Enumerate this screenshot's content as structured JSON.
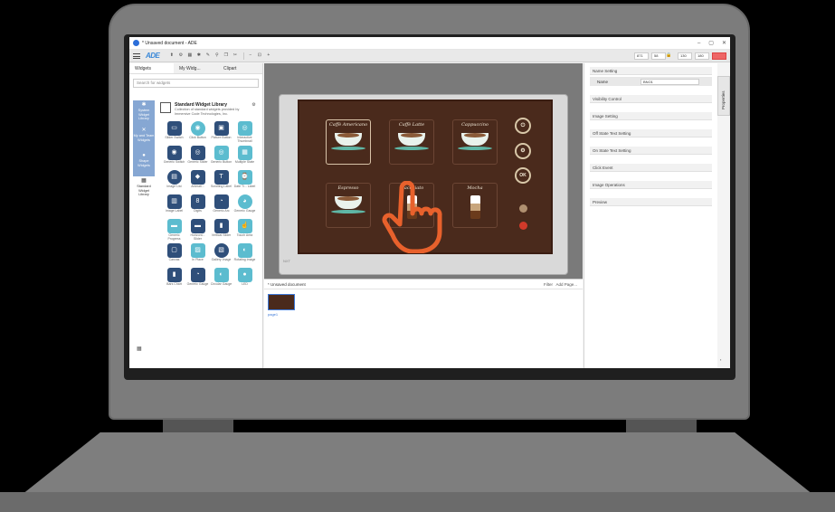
{
  "window": {
    "title": "* Unsaved document - ADE",
    "minimize": "–",
    "maximize": "▢",
    "close": "✕"
  },
  "toolbar": {
    "logo": "ADE",
    "fields": [
      "871",
      "58",
      "130",
      "180"
    ]
  },
  "left_panel": {
    "tabs": [
      "Widgets",
      "My Widg...",
      "Clipart"
    ],
    "search_placeholder": "Search for widgets",
    "categories": [
      {
        "label": "System Widget Library",
        "icon": "✱"
      },
      {
        "label": "My and Team Widgets",
        "icon": "✕"
      },
      {
        "label": "Shape Widgets",
        "icon": "●"
      },
      {
        "label": "Standard Widget Library",
        "icon": "▦"
      }
    ],
    "library": {
      "title": "Standard Widget Library",
      "description": "Collection of standard widgets provided by Immersive Code Technologies, Inc."
    },
    "widgets": [
      "Slider Switch",
      "Click Button",
      "Picture Button",
      "Interactive Thumbnail",
      "Generic Switch",
      "Generic Slider",
      "Generic Button",
      "Multiple State",
      "Image List",
      "Animati...",
      "Scrolling Label",
      "Date Ti... Label",
      "Image Label",
      "Digits",
      "Generic Arc",
      "Generic Gauge",
      "Generic Progress",
      "Horizont... Slider",
      "Vertical Slider",
      "Touch Area",
      "Canvas",
      "In Place",
      "Gallery Image",
      "Rotating Image",
      "Bars Chart",
      "Generic Gauge",
      "Circular Gauge",
      "LED"
    ]
  },
  "canvas": {
    "coffees": [
      {
        "name": "Caffè Americano"
      },
      {
        "name": "Caffè Latte"
      },
      {
        "name": "Cappuccino"
      },
      {
        "name": "Espresso"
      },
      {
        "name": "Macchiato"
      },
      {
        "name": "Mocha"
      }
    ],
    "ok_label": "OK",
    "page_marker": "NXT"
  },
  "document": {
    "title": "* Unsaved document",
    "filter": "Filter",
    "add_page": "Add Page...",
    "page_label": "page1"
  },
  "properties": {
    "tab_label": "Properties",
    "sections": [
      "Name Setting",
      "Visibility Control",
      "Image Setting",
      "Off State Text Setting",
      "On State Text Setting",
      "Click Event",
      "Image Operations",
      "Preview"
    ],
    "name_label": "Name",
    "name_value": "BNO1"
  }
}
